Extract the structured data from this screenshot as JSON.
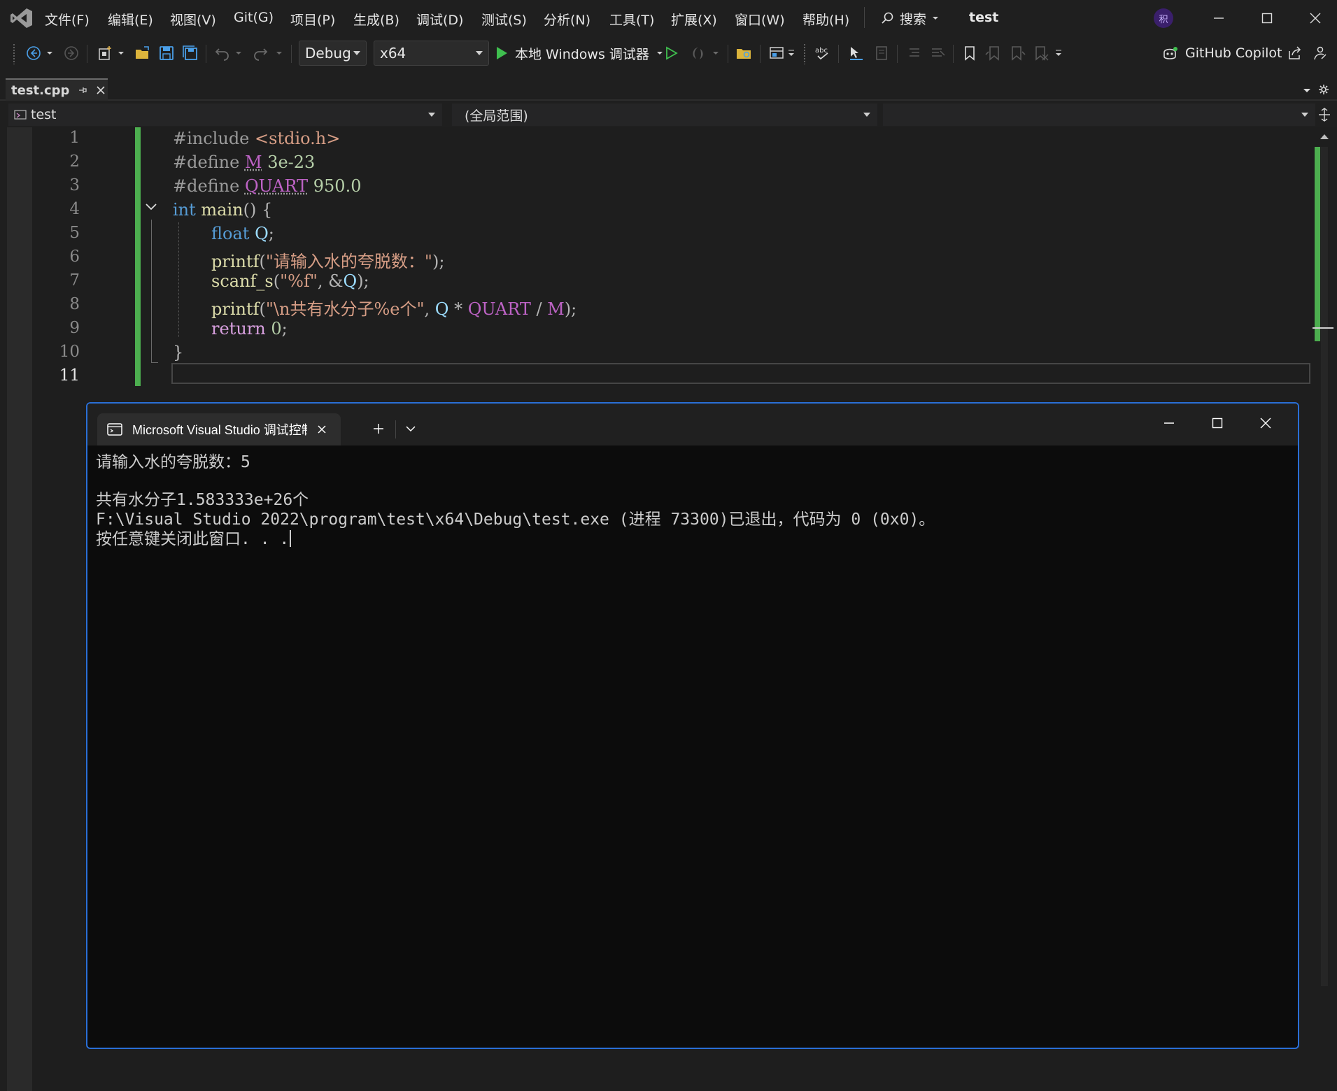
{
  "menubar": {
    "items": [
      "文件(F)",
      "编辑(E)",
      "视图(V)",
      "Git(G)",
      "项目(P)",
      "生成(B)",
      "调试(D)",
      "测试(S)",
      "分析(N)",
      "工具(T)",
      "扩展(X)",
      "窗口(W)",
      "帮助(H)"
    ],
    "search_label": "搜索",
    "window_title": "test",
    "user_initial": "积"
  },
  "toolbar": {
    "configuration": "Debug",
    "platform": "x64",
    "run_label": "本地 Windows 调试器",
    "copilot_label": "GitHub Copilot"
  },
  "document_tab": {
    "label": "test.cpp"
  },
  "navbar": {
    "project": "test",
    "scope": "(全局范围)",
    "member": ""
  },
  "editor": {
    "line_numbers": [
      "1",
      "2",
      "3",
      "4",
      "5",
      "6",
      "7",
      "8",
      "9",
      "10",
      "11"
    ],
    "current_line": "11",
    "code": {
      "l1_a": "#include ",
      "l1_b": "<stdio.h>",
      "l2_a": "#define ",
      "l2_b": "M",
      "l2_c": " 3e-23",
      "l3_a": "#define ",
      "l3_b": "QUART",
      "l3_c": " 950.0",
      "l4_a": "int",
      "l4_b": " ",
      "l4_c": "main",
      "l4_d": "() {",
      "l5_a": "float",
      "l5_b": " ",
      "l5_c": "Q",
      "l5_d": ";",
      "l6_a": "printf",
      "l6_b": "(",
      "l6_c": "\"请输入水的夸脱数：\"",
      "l6_d": ");",
      "l7_a": "scanf_s",
      "l7_b": "(",
      "l7_c": "\"%f\"",
      "l7_d": ", &",
      "l7_e": "Q",
      "l7_f": ");",
      "l8_a": "printf",
      "l8_b": "(",
      "l8_c": "\"\\n共有水分子%e个\"",
      "l8_d": ", ",
      "l8_e": "Q",
      "l8_f": " * ",
      "l8_g": "QUART",
      "l8_h": " / ",
      "l8_i": "M",
      "l8_j": ");",
      "l9_a": "return",
      "l9_b": " ",
      "l9_c": "0",
      "l9_d": ";",
      "l10_a": "}"
    }
  },
  "console": {
    "tab_label": "Microsoft Visual Studio 调试控制台",
    "lines": [
      "请输入水的夸脱数：5",
      "",
      "共有水分子1.583333e+26个",
      "F:\\Visual Studio 2022\\program\\test\\x64\\Debug\\test.exe (进程 73300)已退出，代码为 0 (0x0)。",
      "按任意键关闭此窗口. . ."
    ]
  },
  "colors": {
    "accent_blue": "#2a6fd6",
    "change_bar_green": "#4cae4f",
    "keyword": "#569cd6",
    "string": "#d69d85",
    "function": "#dcdcaa",
    "macro": "#bd63c5"
  }
}
